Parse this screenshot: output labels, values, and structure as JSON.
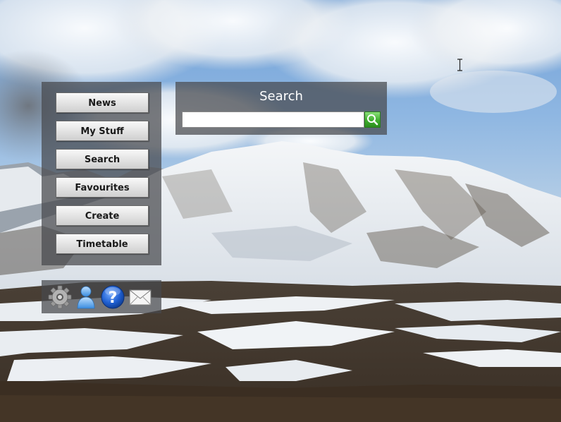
{
  "nav": {
    "items": [
      {
        "label": "News"
      },
      {
        "label": "My Stuff"
      },
      {
        "label": "Search"
      },
      {
        "label": "Favourites"
      },
      {
        "label": "Create"
      },
      {
        "label": "Timetable"
      }
    ]
  },
  "search": {
    "title": "Search",
    "value": "",
    "placeholder": ""
  },
  "toolbar": {
    "icons": [
      "gear-icon",
      "user-icon",
      "help-icon",
      "mail-icon"
    ]
  },
  "colors": {
    "panel": "#46484c",
    "button_top": "#f9f9f9",
    "button_bottom": "#cfcfcf",
    "search_go": "#3fae2e",
    "help_blue": "#1f5fd1"
  }
}
